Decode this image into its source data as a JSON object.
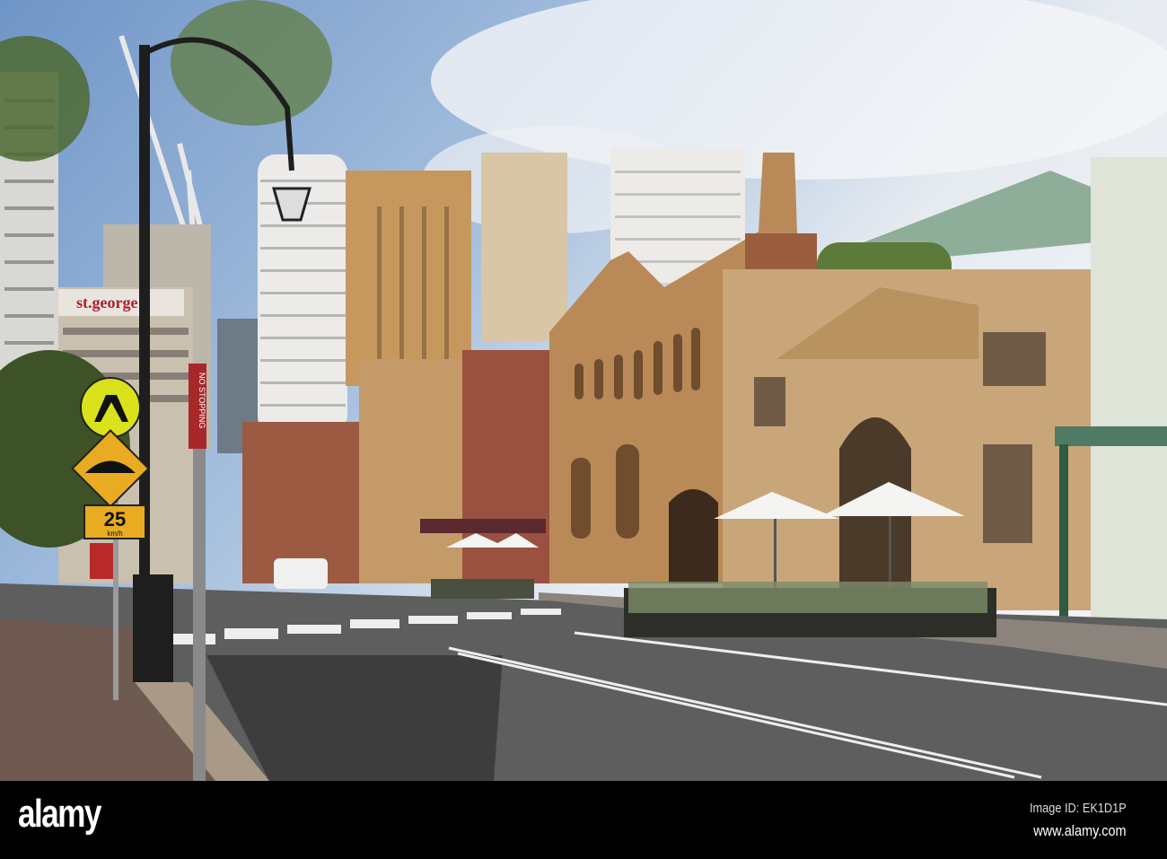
{
  "watermark": {
    "logo": "alamy",
    "image_id": "Image ID: EK1D1P",
    "site": "www.alamy.com"
  },
  "signs": {
    "bank_sign": "st.george",
    "speed_limit": "25",
    "speed_unit": "km/h",
    "no_stopping": "NO STOPPING"
  },
  "colors": {
    "sky": "#8fb0d6",
    "sandstone": "#b98a57",
    "road": "#5c5c5c",
    "sign_yellow": "#d9e21a"
  }
}
